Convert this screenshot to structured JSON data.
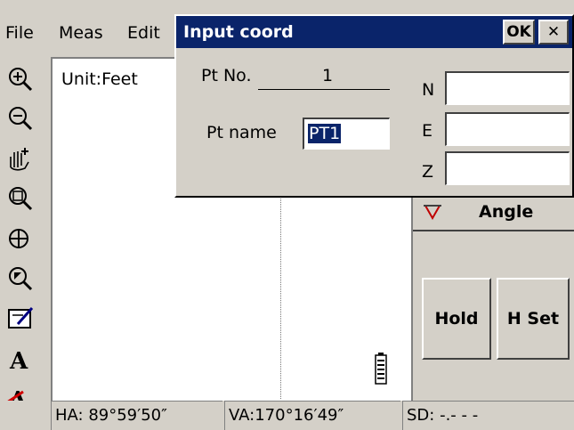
{
  "menu": {
    "items": [
      "File",
      "Meas",
      "Edit"
    ]
  },
  "canvas": {
    "unit_label": "Unit:Feet"
  },
  "right_panel": {
    "angle_label": "Angle",
    "hold_label": "Hold",
    "hset_label": "H Set"
  },
  "status": {
    "ha": "HA: 89°59′50″",
    "va": "VA:170°16′49″",
    "sd": "SD:   -.- - -"
  },
  "dialog": {
    "title": "Input coord",
    "ok_label": "OK",
    "close_label": "✕",
    "pt_no_label": "Pt No.",
    "pt_no_value": "1",
    "pt_name_label": "Pt name",
    "pt_name_value": "PT1",
    "n_label": "N",
    "e_label": "E",
    "z_label": "Z",
    "n_value": "",
    "e_value": "",
    "z_value": ""
  },
  "toolbar_icons": [
    "zoom-in-icon",
    "zoom-out-icon",
    "pan-hand-icon",
    "zoom-window-icon",
    "zoom-extents-icon",
    "zoom-previous-icon",
    "edit-layer-icon",
    "text-icon",
    "text-settings-icon"
  ],
  "colors": {
    "titlebar": "#0a246a",
    "selection": "#0a246a",
    "angle_marker": "#c00000",
    "face": "#d4d0c8"
  }
}
